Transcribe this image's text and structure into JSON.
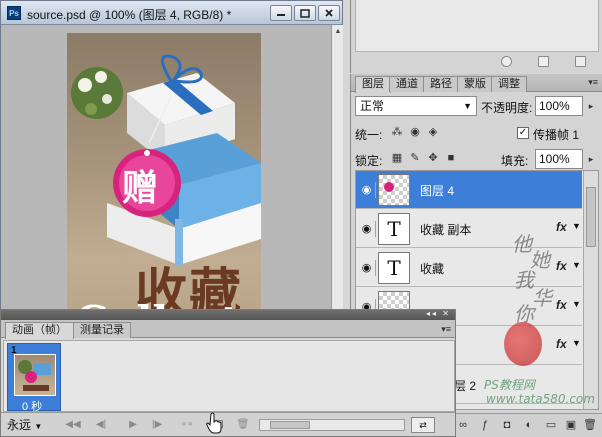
{
  "document": {
    "title": "source.psd @ 100% (图层 4, RGB/8) *",
    "app_icon": "Ps",
    "buttons": {
      "minimize": "minimize-icon",
      "maximize": "maximize-icon",
      "close": "close-icon"
    },
    "artwork": {
      "tag_text": "赠",
      "headline": "收藏",
      "subline": "Collect"
    }
  },
  "layers_panel": {
    "tabs": [
      "图层",
      "通道",
      "路径",
      "蒙版",
      "调整"
    ],
    "active_tab": "图层",
    "blend_mode": "正常",
    "opacity_label": "不透明度:",
    "opacity_value": "100%",
    "unify_label": "统一:",
    "propagate_label": "传播帧 1",
    "propagate_checked": "✓",
    "lock_label": "锁定:",
    "fill_label": "填充:",
    "fill_value": "100%",
    "layers": [
      {
        "name": "图层 4",
        "type": "raster",
        "selected": true,
        "fx": ""
      },
      {
        "name": "收藏 副本",
        "type": "text",
        "selected": false,
        "fx": "fx"
      },
      {
        "name": "收藏",
        "type": "text",
        "selected": false,
        "fx": "fx"
      },
      {
        "name": "",
        "type": "raster",
        "selected": false,
        "fx": "fx"
      },
      {
        "name": "",
        "type": "raster",
        "selected": false,
        "fx": "fx"
      },
      {
        "name": "层 2",
        "type": "raster",
        "selected": false,
        "fx": ""
      }
    ],
    "text_thumb_glyph": "T"
  },
  "watermark": {
    "signature": [
      "他",
      "她",
      "我",
      "华",
      "你"
    ],
    "site_name": "PS教程网",
    "site_url": "www.tata580.com"
  },
  "animation_panel": {
    "tabs": [
      "动画（帧）",
      "测量记录"
    ],
    "active_tab": "动画（帧）",
    "frames": [
      {
        "number": "1",
        "delay": "0 秒"
      }
    ],
    "loop": "永远",
    "colors": {
      "selection": "#3d7fd8"
    }
  }
}
